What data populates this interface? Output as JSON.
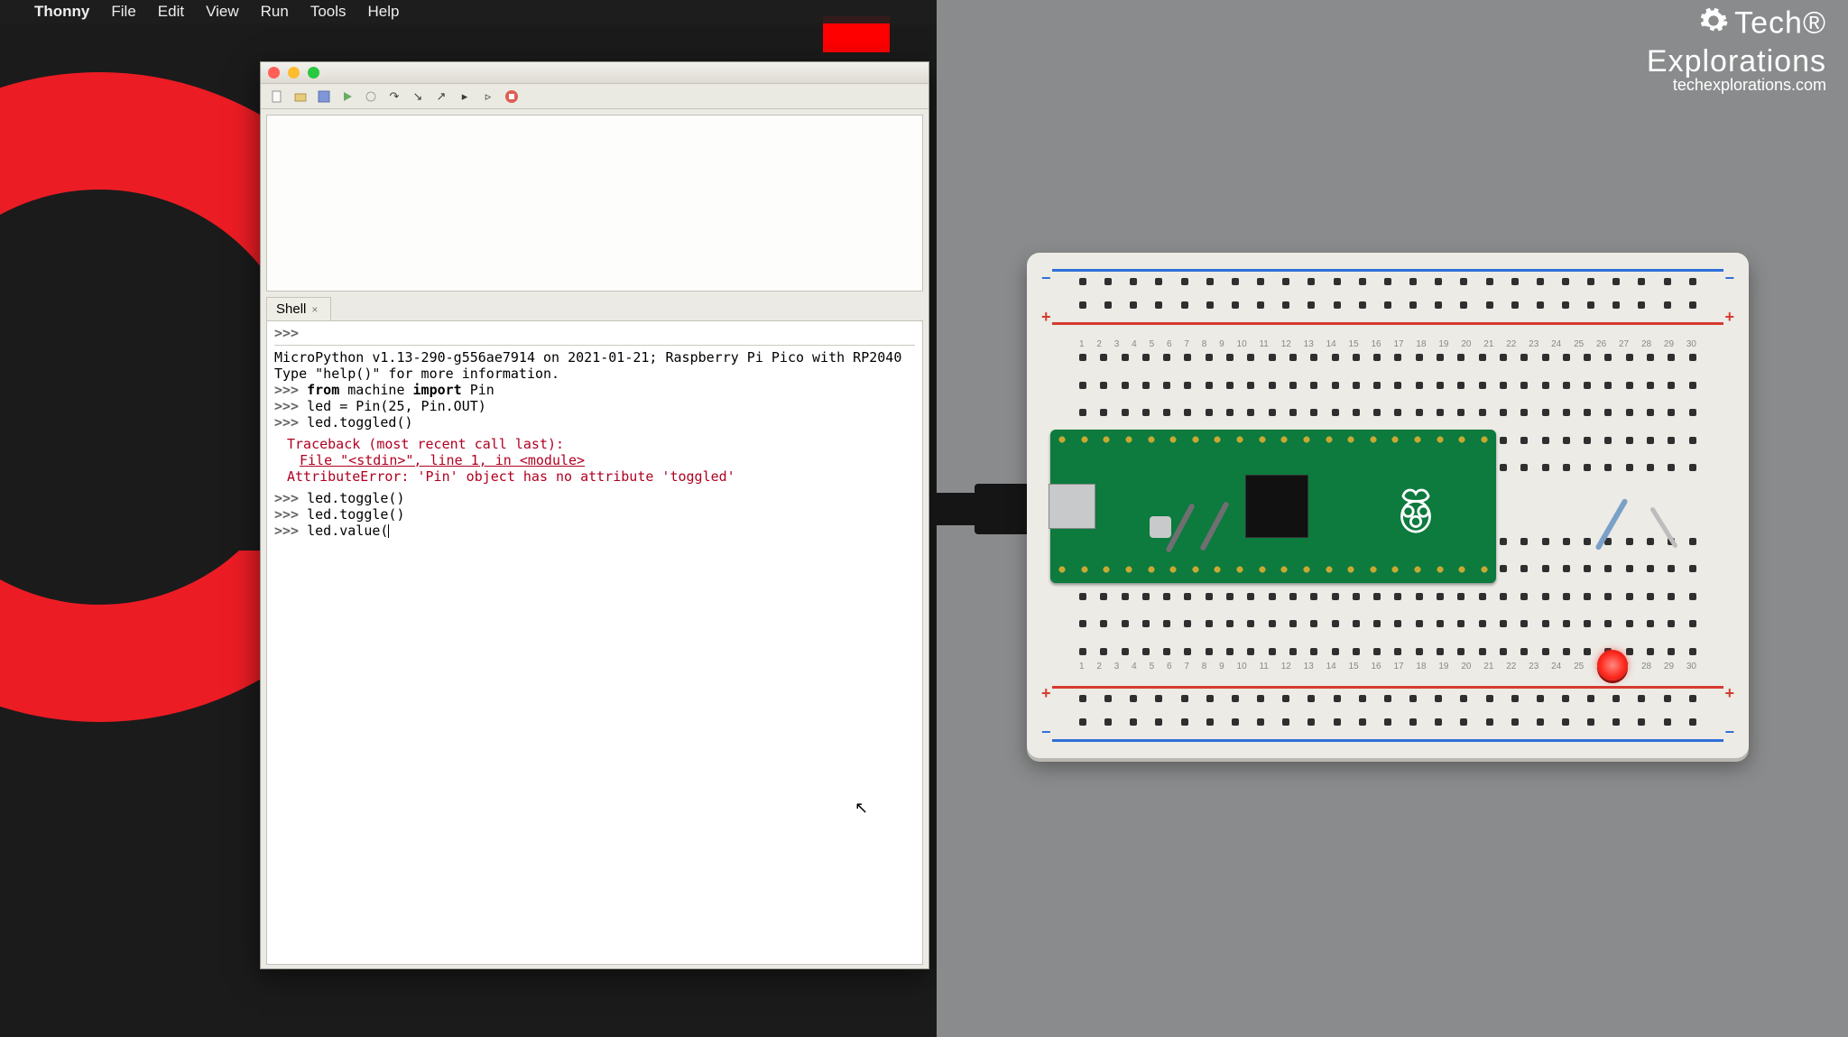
{
  "menubar": {
    "appname": "Thonny",
    "items": [
      "File",
      "Edit",
      "View",
      "Run",
      "Tools",
      "Help"
    ]
  },
  "thonny": {
    "shell_tab": "Shell",
    "prompt": ">>>",
    "banner1": "MicroPython v1.13-290-g556ae7914 on 2021-01-21; Raspberry Pi Pico with RP2040",
    "banner2": "Type \"help()\" for more information.",
    "lines": [
      {
        "prompt": ">>>",
        "kw1": "from",
        "t1": " machine ",
        "kw2": "import",
        "t2": " Pin"
      },
      {
        "prompt": ">>>",
        "t": "led = Pin(25, Pin.OUT)"
      },
      {
        "prompt": ">>>",
        "t": "led.toggled()"
      }
    ],
    "traceback": {
      "head": "Traceback (most recent call last):",
      "file": "File \"<stdin>\", line 1, in <module>",
      "err": "AttributeError: 'Pin' object has no attribute 'toggled'"
    },
    "lines2": [
      {
        "prompt": ">>>",
        "t": "led.toggle()"
      },
      {
        "prompt": ">>>",
        "t": "led.toggle()"
      },
      {
        "prompt": ">>>",
        "t": "led.value("
      }
    ]
  },
  "brand": {
    "line1a": "Tech",
    "line1b": "Explorations",
    "line2": "techexplorations.com"
  },
  "toolbar_icons": [
    "new-file-icon",
    "open-file-icon",
    "save-icon",
    "run-icon",
    "debug-icon",
    "step-over-icon",
    "step-into-icon",
    "step-out-icon",
    "resume-icon",
    "run-to-cursor-icon",
    "stop-icon"
  ],
  "breadboard": {
    "cols": 30
  }
}
